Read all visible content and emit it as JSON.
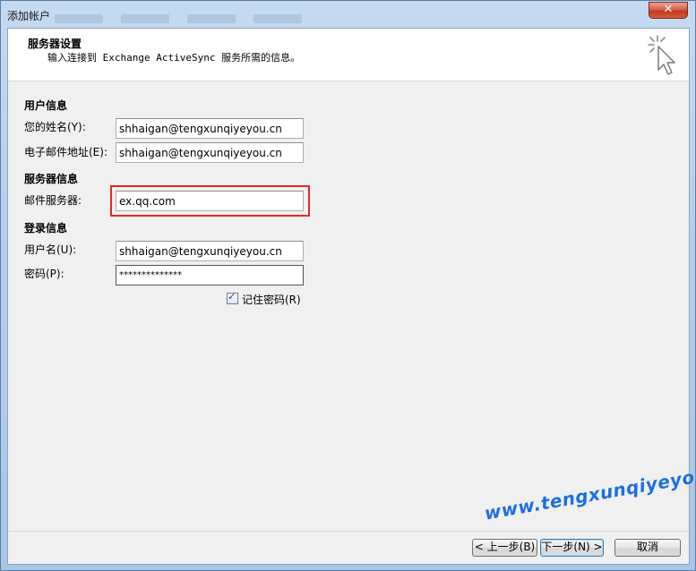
{
  "window": {
    "title": "添加帐户",
    "close_label": "✕"
  },
  "header": {
    "title": "服务器设置",
    "subtitle": "输入连接到 Exchange ActiveSync 服务所需的信息。"
  },
  "user_info": {
    "section_label": "用户信息",
    "name_label": "您的姓名(Y):",
    "name_value": "shhaigan@tengxunqiyeyou.cn",
    "email_label": "电子邮件地址(E):",
    "email_value": "shhaigan@tengxunqiyeyou.cn"
  },
  "server_info": {
    "section_label": "服务器信息",
    "server_label": "邮件服务器:",
    "server_value": "ex.qq.com",
    "highlight_color": "#e02a2a"
  },
  "login_info": {
    "section_label": "登录信息",
    "username_label": "用户名(U):",
    "username_value": "shhaigan@tengxunqiyeyou.cn",
    "password_label": "密码(P):",
    "password_value": "**************",
    "remember_label": "记住密码(R)",
    "remember_checked": true
  },
  "footer": {
    "back_label": "< 上一步(B)",
    "next_label": "下一步(N) >",
    "cancel_label": "取消"
  },
  "watermark": {
    "text": "www.tengxunqiyeyou.com",
    "color": "#1d6fe0"
  },
  "icons": {
    "header": "cursor-sparkle-icon",
    "close": "close-icon",
    "checkbox": "checkmark-icon"
  }
}
